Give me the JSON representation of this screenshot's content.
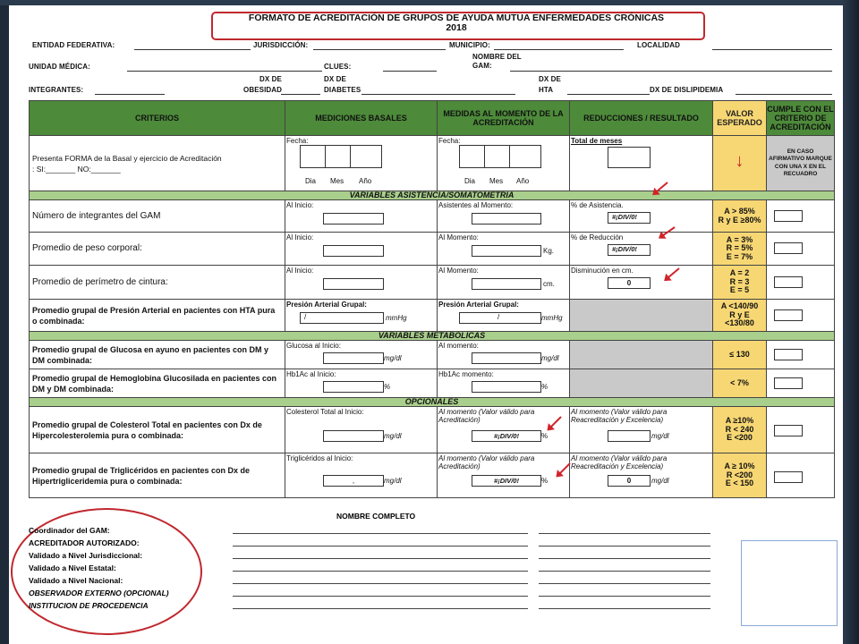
{
  "title": {
    "line1": "FORMATO DE ACREDITACIÓN DE GRUPOS DE AYUDA MUTUA ENFERMEDADES CRÓNICAS",
    "line2": "2018"
  },
  "fields": {
    "entidad": "ENTIDAD FEDERATIVA:",
    "jurisdiccion": "JURISDICCIÓN:",
    "municipio": "MUNICIPIO:",
    "localidad": "LOCALIDAD",
    "unidad": "UNIDAD MÉDICA:",
    "clues": "CLUES:",
    "nombre_gam_1": "NOMBRE DEL",
    "nombre_gam_2": "GAM:",
    "integrantes": "INTEGRANTES:",
    "dx_obesidad_1": "DX DE",
    "dx_obesidad_2": "OBESIDAD",
    "dx_diabetes_1": "DX DE",
    "dx_diabetes_2": "DIABETES",
    "dx_hta_1": "DX DE",
    "dx_hta_2": "HTA",
    "dx_dislipidemia": "DX DE DISLIPIDEMIA"
  },
  "headers": {
    "criterios": "CRITERIOS",
    "basales": "MEDICIONES BASALES",
    "momento": "MEDIDAS AL MOMENTO DE LA ACREDITACIÓN",
    "reducciones": "REDUCCIONES / RESULTADO",
    "esperado": "VALOR ESPERADO",
    "cumple": "CUMPLE CON EL CRITERIO DE ACREDITACIÓN"
  },
  "row_forma": {
    "criterio": "Presenta FORMA de la Basal y ejercicio de Acreditación",
    "si_no": ": SI:_______ NO:_______",
    "fecha": "Fecha:",
    "dia": "Dia",
    "mes": "Mes",
    "anio": "Año",
    "total_meses": "Total de meses",
    "cumple_text": "EN CASO AFIRMATIVO MARQUE CON UNA X EN EL RECUADRO"
  },
  "sections": {
    "asistencia": "VARIABLES ASISTENCIA/SOMATOMETRIA",
    "metabolicas": "VARIABLES METABÓLICAS",
    "opcionales": "OPCIONALES"
  },
  "rows": [
    {
      "criterio": "Número de integrantes del GAM",
      "basal": "Al Inicio:",
      "momento": "Asistentes al Momento:",
      "reduccion": "% de Asistencia.",
      "reduccion_val": "#¡DIV/0!",
      "esperado": "A > 85%",
      "esperado2": "R y E ≥80%"
    },
    {
      "criterio": "Promedio de peso corporal:",
      "basal": "Al Inicio:",
      "momento": "Al Momento:",
      "momento_unit": "Kg.",
      "reduccion": "% de Reducción",
      "reduccion_val": "#¡DIV/0!",
      "esperado": "A = 3%",
      "esperado2": "R = 5%",
      "esperado3": "E = 7%"
    },
    {
      "criterio": "Promedio de perímetro de cintura:",
      "basal": "Al Inicio:",
      "momento": "Al Momento:",
      "momento_unit": "cm.",
      "reduccion": "Disminución en cm.",
      "reduccion_val": "0",
      "esperado": "A = 2",
      "esperado2": "R = 3",
      "esperado3": "E = 5"
    },
    {
      "criterio": "Promedio grupal de Presión Arterial en pacientes con HTA pura o combinada:",
      "basal": "Presión Arterial Grupal:",
      "basal_unit": "mmHg",
      "momento": "Presión Arterial Grupal:",
      "momento_unit": "mmHg",
      "esperado": "A <140/90",
      "esperado2": "R y E",
      "esperado3": "<130/80"
    },
    {
      "criterio": "Promedio grupal de Glucosa en ayuno en pacientes con DM y DM combinada:",
      "basal": "Glucosa al Inicio:",
      "basal_unit": "mg/dl",
      "momento": "Al momento:",
      "momento_unit": "mg/dl",
      "esperado": "≤ 130"
    },
    {
      "criterio": "Promedio grupal de Hemoglobina Glucosilada en pacientes con DM y DM combinada:",
      "basal": "Hb1Ac al Inicio:",
      "basal_unit": "%",
      "momento": "Hb1Ac momento:",
      "momento_unit": "%",
      "esperado": "< 7%"
    },
    {
      "criterio": "Promedio grupal de Colesterol Total en pacientes con Dx de Hipercolesterolemia pura o combinada:",
      "basal": "Colesterol Total al Inicio:",
      "basal_unit": "mg/dl",
      "momento": "Al momento (Valor válido para Acreditación)",
      "momento_val": "#¡DIV/0!",
      "momento_unit": "%",
      "reduccion": "Al momento (Valor válido para Reacreditación y Excelencia)",
      "reduccion_unit": "mg/dl",
      "esperado": "A ≥10%",
      "esperado2": "R < 240",
      "esperado3": "E <200"
    },
    {
      "criterio": "Promedio grupal de Triglicéridos en pacientes con Dx de Hipertrigliceridemia pura o combinada:",
      "basal": "Triglicéridos al Inicio:",
      "basal_unit": "mg/dl",
      "momento": "Al momento (Valor válido para Acreditación)",
      "momento_val": "#¡DIV/0!",
      "momento_unit": "%",
      "reduccion": "Al momento (Valor válido para Reacreditación y Excelencia)",
      "reduccion_val": "0",
      "reduccion_unit": "mg/dl",
      "esperado": "A ≥ 10%",
      "esperado2": "R <200",
      "esperado3": "E < 150"
    }
  ],
  "signatures": {
    "nombre_completo": "NOMBRE COMPLETO",
    "items": [
      "Coordinador del GAM:",
      "ACREDITADOR AUTORIZADO:",
      "Validado a Nivel Jurisdiccional:",
      "Validado a Nivel Estatal:",
      "Validado a Nivel Nacional:",
      "OBSERVADOR EXTERNO (OPCIONAL)",
      "INSTITUCION DE PROCEDENCIA"
    ]
  },
  "colors": {
    "header_green": "#4d8a3a",
    "section_green": "#a9cf8c",
    "expected_yellow": "#f7d774",
    "annotation_red": "#c0282e"
  }
}
